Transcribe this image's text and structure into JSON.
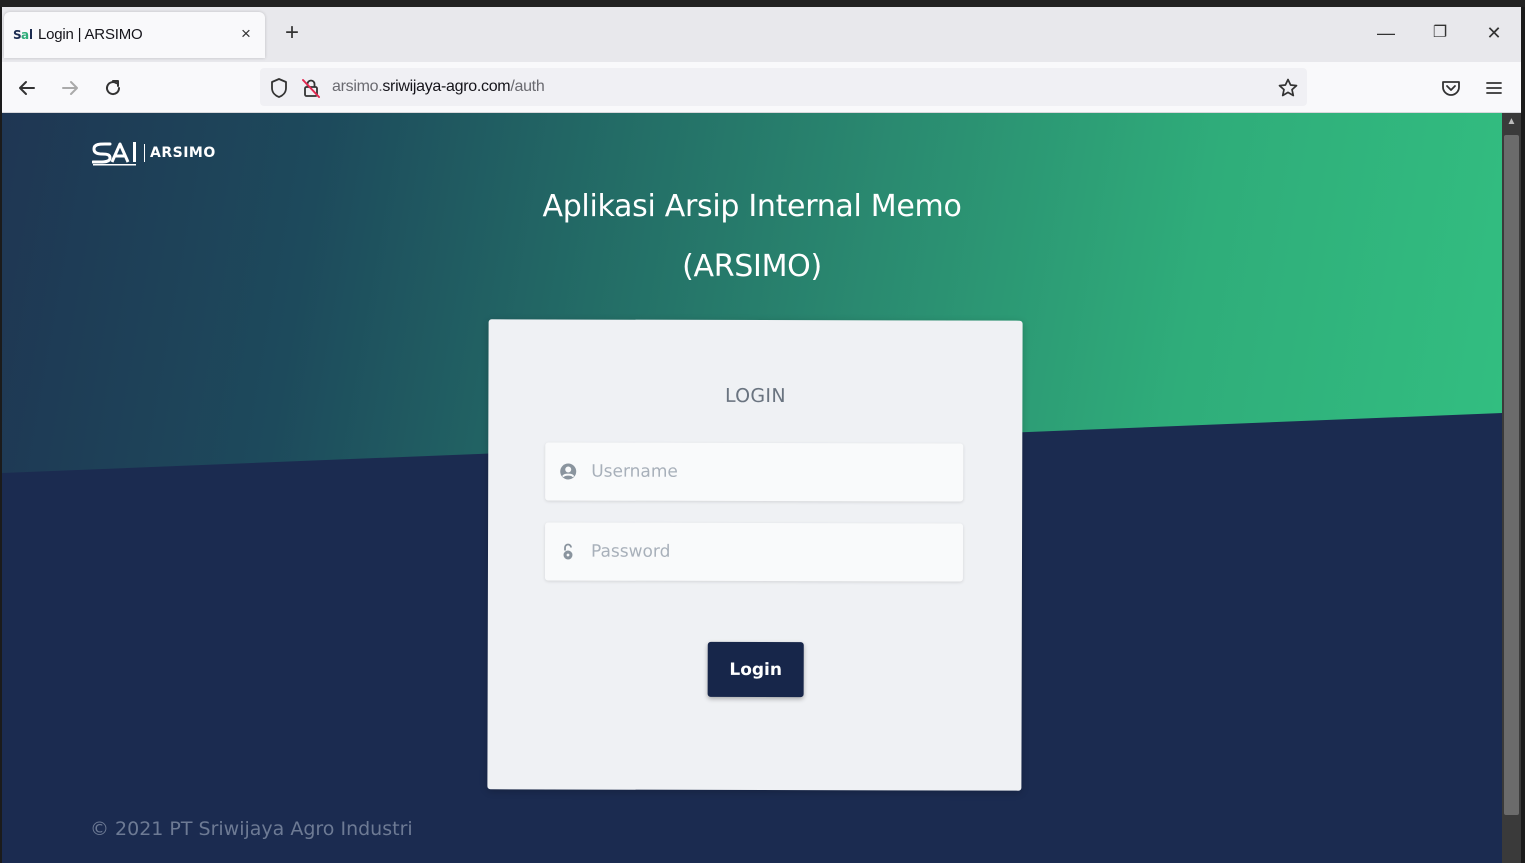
{
  "browser": {
    "tab_title": "Login | ARSIMO",
    "tab_close": "×",
    "new_tab": "+",
    "window": {
      "minimize": "—",
      "restore": "❐",
      "close": "✕"
    },
    "url_prefix": "arsimo.",
    "url_host": "sriwijaya-agro.com",
    "url_path": "/auth"
  },
  "page": {
    "logo_text": "ARSIMO",
    "title_line1": "Aplikasi Arsip Internal Memo",
    "title_line2": "(ARSIMO)",
    "login": {
      "heading": "LOGIN",
      "username_placeholder": "Username",
      "password_placeholder": "Password",
      "submit_label": "Login"
    },
    "footer": "© 2021 PT Sriwijaya Agro Industri"
  },
  "colors": {
    "navy": "#1b2b50",
    "green": "#33c282",
    "button": "#17264a"
  }
}
